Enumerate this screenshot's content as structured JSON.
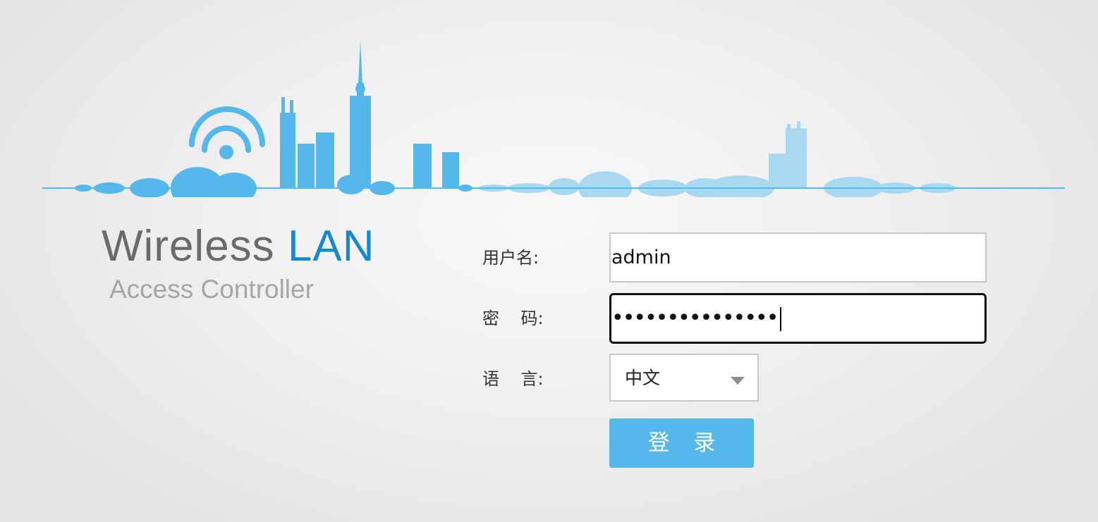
{
  "brand": {
    "title_part1": "Wireless",
    "title_part2": "LAN",
    "subtitle": "Access Controller"
  },
  "form": {
    "username_label": "用户名:",
    "password_label": "密    码:",
    "language_label": "语    言:",
    "username_value": "admin",
    "password_masked": "•••••••••••••••",
    "language_selected": "中文",
    "login_label": "登 录"
  },
  "colors": {
    "skyline_dark": "#55b8ea",
    "skyline_light": "#a9d9f1",
    "brand_blue": "#1489cf",
    "brand_gray": "#6b6b6b",
    "button": "#56b8ea"
  },
  "icons": {
    "logo": "wifi-skyline-icon",
    "dropdown": "chevron-down-icon"
  }
}
